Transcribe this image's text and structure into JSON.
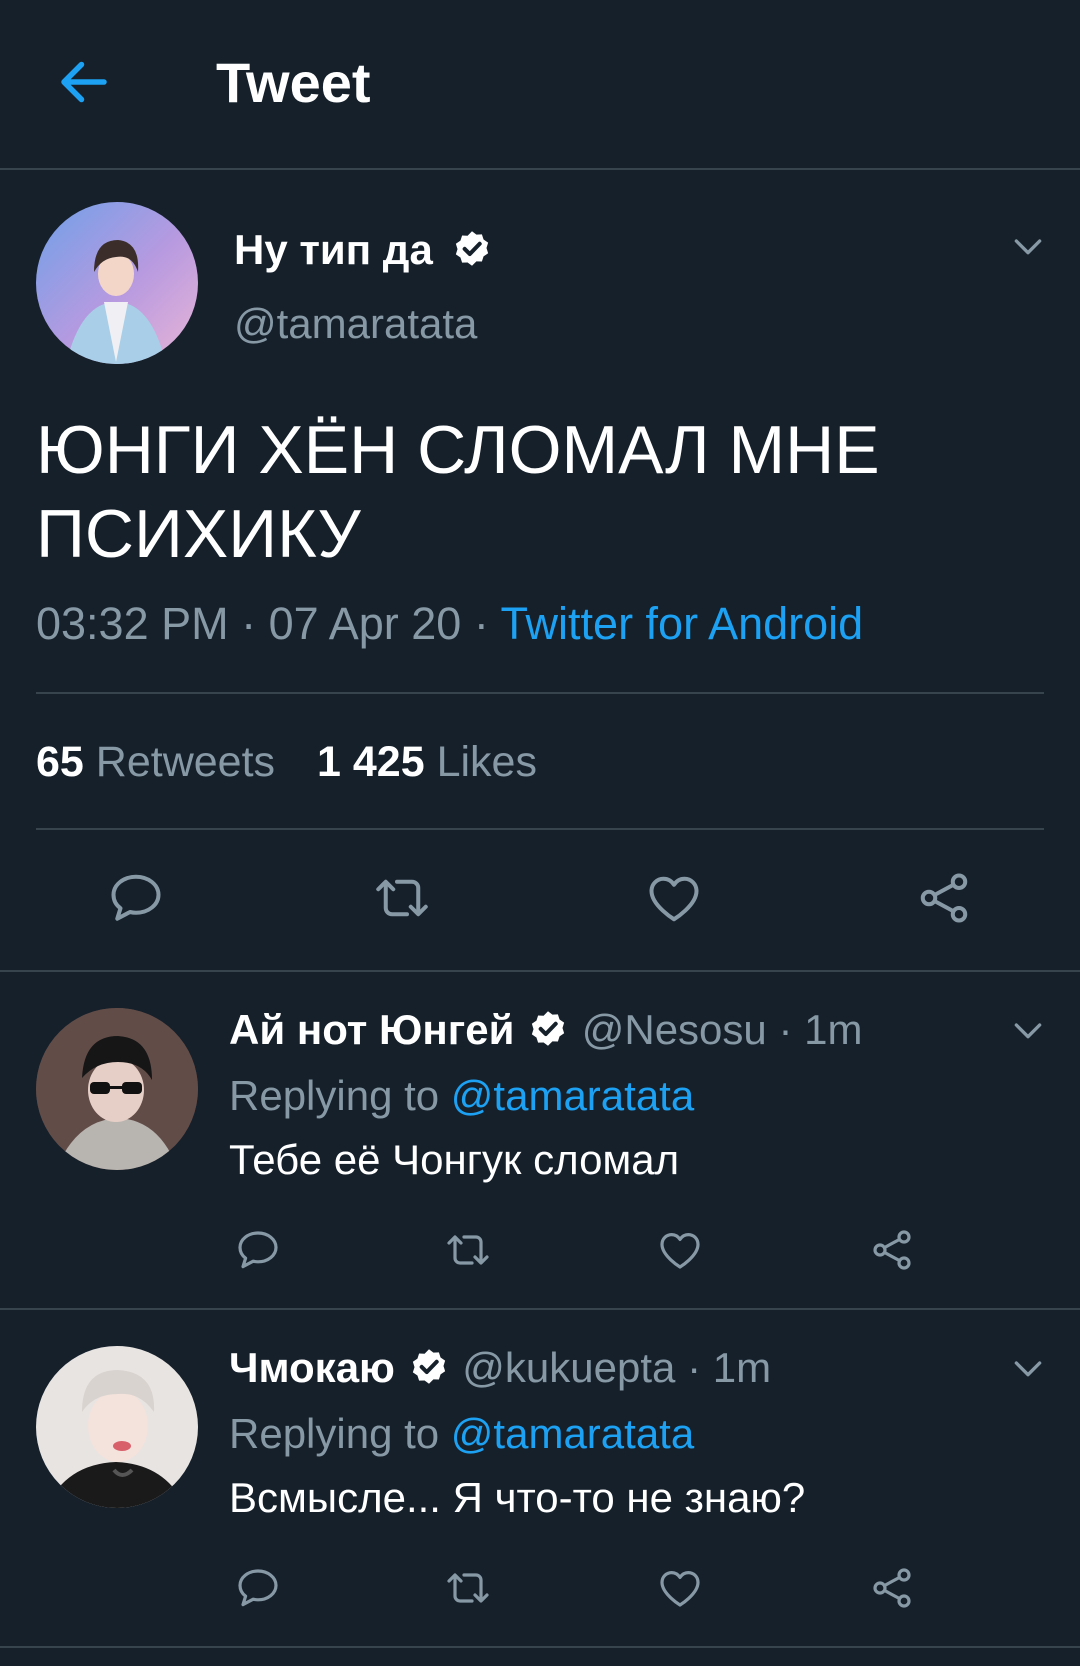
{
  "header": {
    "title": "Tweet",
    "back_icon": "arrow-left-icon"
  },
  "colors": {
    "background": "#15202b",
    "accent": "#1da1f2",
    "muted": "#8899a6",
    "divider": "#38444d"
  },
  "tweet": {
    "author_name": "Ну тип да",
    "author_handle": "@tamaratata",
    "text": "ЮНГИ ХЁН СЛОМАЛ МНЕ ПСИХИКУ",
    "time": "03:32 PM",
    "date": "07 Apr 20",
    "separator": "·",
    "source": "Twitter for Android",
    "retweets_count": "65",
    "retweets_label": "Retweets",
    "likes_count": "1 425",
    "likes_label": "Likes"
  },
  "replies": [
    {
      "name": "Ай нот Юнгей",
      "handle": "@Nesosu",
      "time": "1m",
      "replying_label": "Replying to",
      "replying_to": "@tamaratata",
      "text": "Тебе её Чонгук сломал"
    },
    {
      "name": "Чмокаю",
      "handle": "@kukuepta",
      "time": "1m",
      "replying_label": "Replying to",
      "replying_to": "@tamaratata",
      "text": "Всмысле... Я что-то не знаю?"
    }
  ],
  "actions": [
    "reply-icon",
    "retweet-icon",
    "like-icon",
    "share-icon"
  ]
}
